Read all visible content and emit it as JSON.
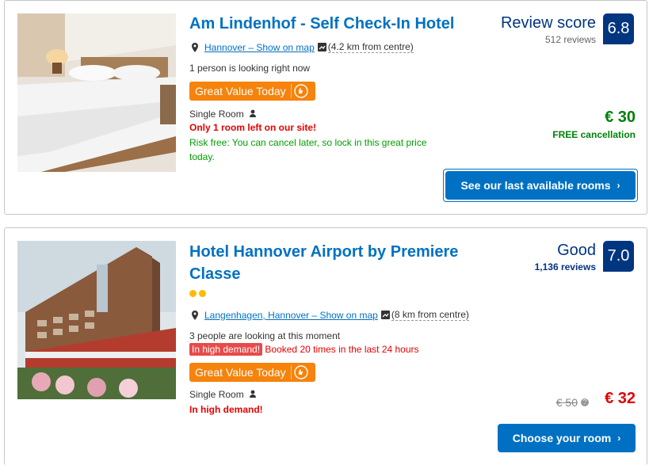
{
  "hotels": [
    {
      "name": "Am Lindenhof - Self Check-In Hotel",
      "location_link": "Hannover – Show on map",
      "distance": "(4.2 km from centre)",
      "social": "1 person is looking right now",
      "deal_label": "Great Value Today",
      "room_type": "Single Room",
      "scarcity": "Only 1 room left on our site!",
      "cancel_note_1": "Risk free: You can cancel later, so lock in this great price",
      "cancel_note_2": "today.",
      "score_word": "Review score",
      "reviews": "512 reviews",
      "score": "6.8",
      "price": "€ 30",
      "free_cancel": "FREE cancellation",
      "cta": "See our last available rooms"
    },
    {
      "name_line1": "Hotel Hannover Airport by Premiere",
      "name_line2": "Classe",
      "location_link": "Langenhagen, Hannover – Show on map",
      "distance": "(8 km from centre)",
      "social": "3 people are looking at this moment",
      "demand_badge": "In high demand!",
      "booked": "Booked 20 times in the last 24 hours",
      "deal_label": "Great Value Today",
      "room_type": "Single Room",
      "demand_note": "In high demand!",
      "score_word": "Good",
      "reviews": "1,136 reviews",
      "score": "7.0",
      "old_price": "€ 50",
      "price": "€ 32",
      "cta": "Choose your room",
      "stars": 2
    }
  ],
  "colors": {
    "link": "#0071c2",
    "score_bg": "#003580",
    "deal_bg": "#f6830b",
    "alert": "#e50000",
    "success": "#009e00",
    "star": "#febb02"
  },
  "icons": [
    "map-pin-icon",
    "map-box-icon",
    "thumbs-up-icon",
    "person-icon",
    "chevron-right-icon",
    "info-icon"
  ]
}
